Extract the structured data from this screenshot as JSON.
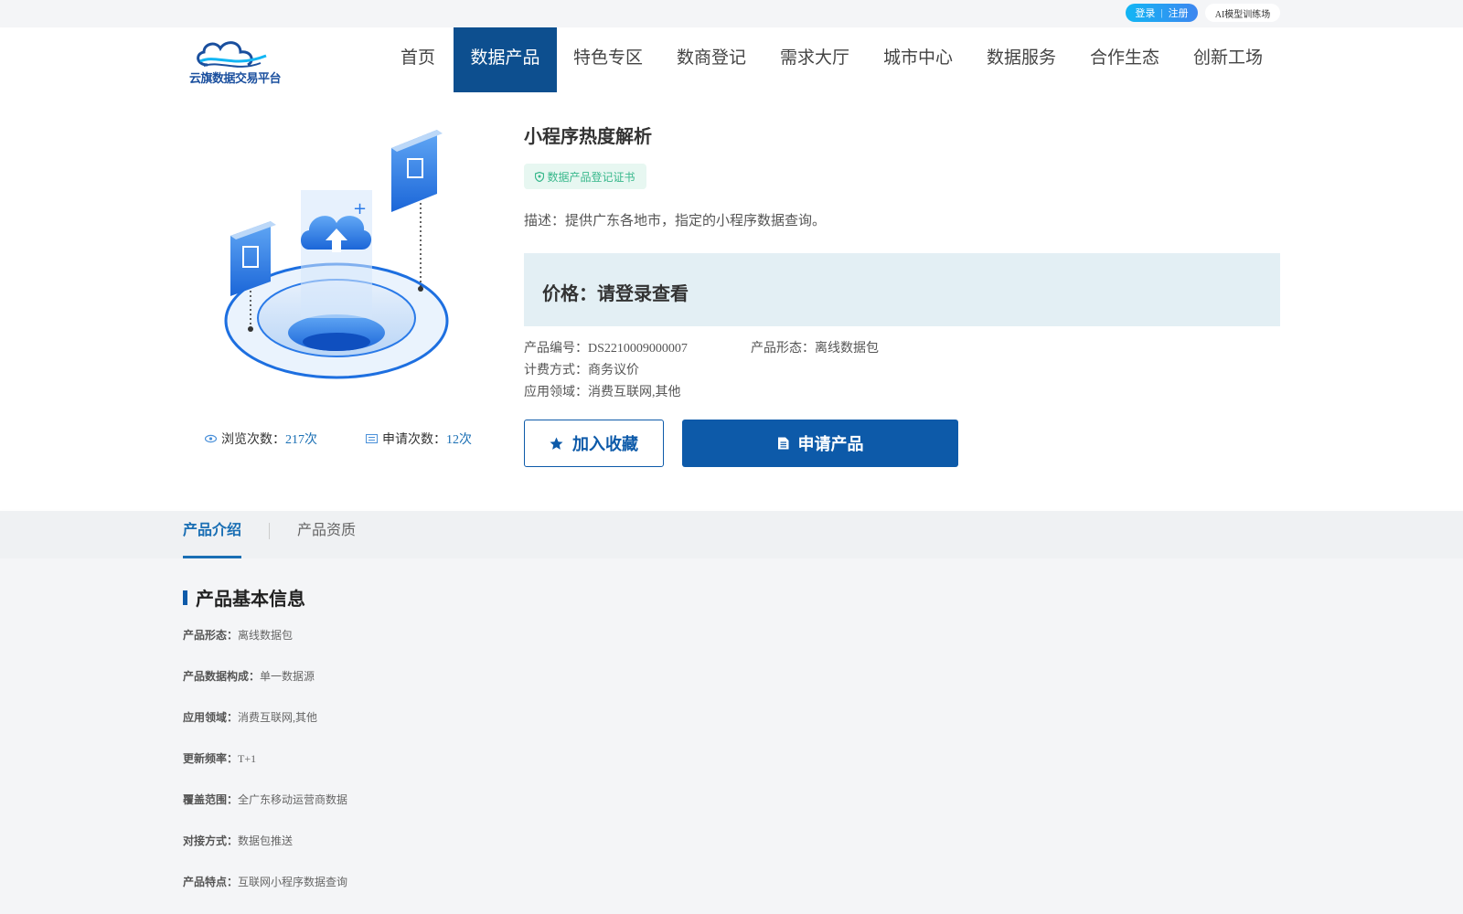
{
  "topbar": {
    "login_label": "登录",
    "divider": "|",
    "register_label": "注册",
    "ai_label": "AI模型训练场"
  },
  "header": {
    "logo_text": "云旗数据交易平台",
    "nav": [
      {
        "label": "首页",
        "active": false
      },
      {
        "label": "数据产品",
        "active": true
      },
      {
        "label": "特色专区",
        "active": false
      },
      {
        "label": "数商登记",
        "active": false
      },
      {
        "label": "需求大厅",
        "active": false
      },
      {
        "label": "城市中心",
        "active": false
      },
      {
        "label": "数据服务",
        "active": false
      },
      {
        "label": "合作生态",
        "active": false
      },
      {
        "label": "创新工场",
        "active": false
      }
    ]
  },
  "product": {
    "title": "小程序热度解析",
    "cert_label": "数据产品登记证书",
    "description": "描述：提供广东各地市，指定的小程序数据查询。",
    "price_label": "价格：请登录查看",
    "code_label": "产品编号：",
    "code_value": "DS2210009000007",
    "form_label": "产品形态：",
    "form_value": "离线数据包",
    "billing_label": "计费方式：",
    "billing_value": "商务议价",
    "field_label": "应用领域：",
    "field_value": "消费互联网,其他",
    "views_label": "浏览次数：",
    "views_value": "217次",
    "applies_label": "申请次数：",
    "applies_value": "12次",
    "fav_button": "加入收藏",
    "apply_button": "申请产品"
  },
  "tabs": [
    {
      "label": "产品介绍",
      "active": true
    },
    {
      "label": "产品资质",
      "active": false
    }
  ],
  "basic_info": {
    "title": "产品基本信息",
    "rows": [
      {
        "key": "产品形态：",
        "value": "离线数据包"
      },
      {
        "key": "产品数据构成：",
        "value": "单一数据源"
      },
      {
        "key": "应用领域：",
        "value": "消费互联网,其他"
      },
      {
        "key": "更新频率：",
        "value": "T+1"
      },
      {
        "key": "覆盖范围：",
        "value": "全广东移动运营商数据"
      },
      {
        "key": "对接方式：",
        "value": "数据包推送"
      },
      {
        "key": "产品特点：",
        "value": "互联网小程序数据查询"
      }
    ]
  },
  "colors": {
    "primary": "#0d5aa9",
    "nav_active": "#0d4f8f",
    "link_blue": "#1a6fb4",
    "price_bg": "#e3eff4",
    "cert_bg": "#e7f7f1",
    "cert_text": "#38b88c"
  },
  "icons": [
    "eye-icon",
    "document-icon",
    "star-icon",
    "shield-icon",
    "cloud-upload-icon"
  ]
}
